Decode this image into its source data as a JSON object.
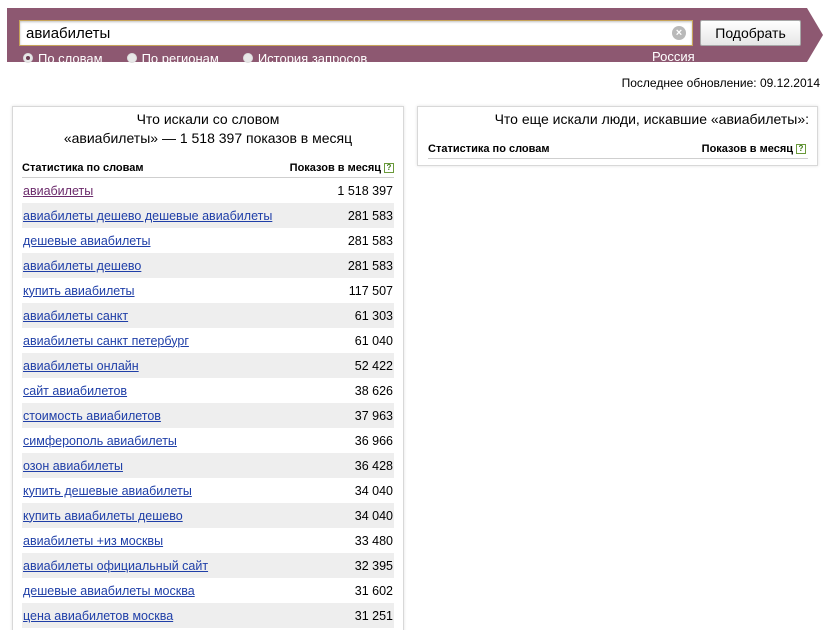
{
  "search": {
    "value": "авиабилеты",
    "clear_glyph": "×",
    "submit_label": "Подобрать"
  },
  "modes": [
    {
      "label": "По словам",
      "checked": true
    },
    {
      "label": "По регионам",
      "checked": false
    },
    {
      "label": "История запросов",
      "checked": false
    }
  ],
  "region": "Россия",
  "last_update": "Последнее обновление: 09.12.2014",
  "left_panel": {
    "title_line1": "Что искали со словом",
    "title_line2": "«авиабилеты» — 1 518 397 показов в месяц",
    "col_words": "Статистика по словам",
    "col_shows": "Показов в месяц",
    "help": "?",
    "rows": [
      {
        "phrase": "авиабилеты",
        "count": "1 518 397"
      },
      {
        "phrase": "авиабилеты дешево дешевые авиабилеты",
        "count": "281 583"
      },
      {
        "phrase": "дешевые авиабилеты",
        "count": "281 583"
      },
      {
        "phrase": "авиабилеты дешево",
        "count": "281 583"
      },
      {
        "phrase": "купить авиабилеты",
        "count": "117 507"
      },
      {
        "phrase": "авиабилеты санкт",
        "count": "61 303"
      },
      {
        "phrase": "авиабилеты санкт петербург",
        "count": "61 040"
      },
      {
        "phrase": "авиабилеты онлайн",
        "count": "52 422"
      },
      {
        "phrase": "сайт авиабилетов",
        "count": "38 626"
      },
      {
        "phrase": "стоимость авиабилетов",
        "count": "37 963"
      },
      {
        "phrase": "симферополь авиабилеты",
        "count": "36 966"
      },
      {
        "phrase": "озон авиабилеты",
        "count": "36 428"
      },
      {
        "phrase": "купить дешевые авиабилеты",
        "count": "34 040"
      },
      {
        "phrase": "купить авиабилеты дешево",
        "count": "34 040"
      },
      {
        "phrase": "авиабилеты +из москвы",
        "count": "33 480"
      },
      {
        "phrase": "авиабилеты официальный сайт",
        "count": "32 395"
      },
      {
        "phrase": "дешевые авиабилеты москва",
        "count": "31 602"
      },
      {
        "phrase": "цена авиабилетов москва",
        "count": "31 251"
      }
    ]
  },
  "right_panel": {
    "title": "Что еще искали люди, искавшие «авиабилеты»:",
    "col_words": "Статистика по словам",
    "col_shows": "Показов в месяц",
    "help": "?"
  },
  "colors": {
    "header_bg": "#8d5871",
    "link": "#1f3fa8",
    "visited_link": "#6b2a6b",
    "row_alt": "#eeeeee"
  }
}
